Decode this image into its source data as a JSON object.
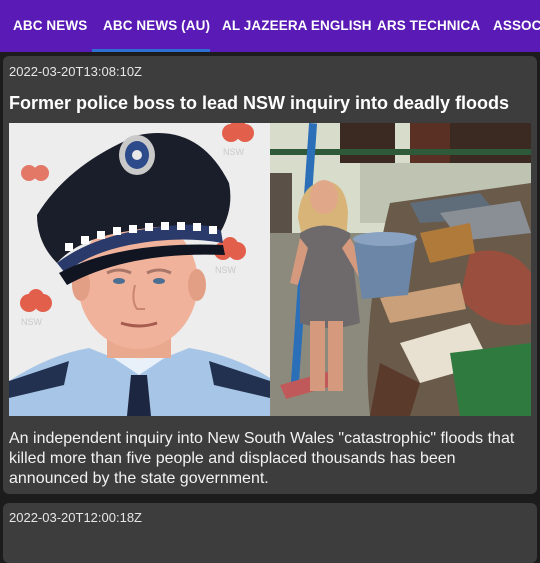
{
  "tabs": [
    {
      "label": "ABC NEWS",
      "selected": false
    },
    {
      "label": "ABC NEWS (AU)",
      "selected": true
    },
    {
      "label": "AL JAZEERA ENGLISH",
      "selected": false
    },
    {
      "label": "ARS TECHNICA",
      "selected": false
    },
    {
      "label": "ASSOCI",
      "selected": false
    }
  ],
  "articles": [
    {
      "timestamp": "2022-03-20T13:08:10Z",
      "headline": "Former police boss to lead NSW inquiry into deadly floods",
      "summary": "An independent inquiry into New South Wales \"catastrophic\" floods that killed more than five people and displaced thousands has been announced by the state government.",
      "images": [
        "police-commissioner-photo",
        "flood-cleanup-photo"
      ],
      "image_text": [
        "NSW"
      ]
    },
    {
      "timestamp": "2022-03-20T12:00:18Z"
    }
  ],
  "colors": {
    "tabbar": "#5a1ab5",
    "tab_indicator": "#2f6fd0",
    "card": "#3d3d3d",
    "background": "#1c1c1c"
  }
}
